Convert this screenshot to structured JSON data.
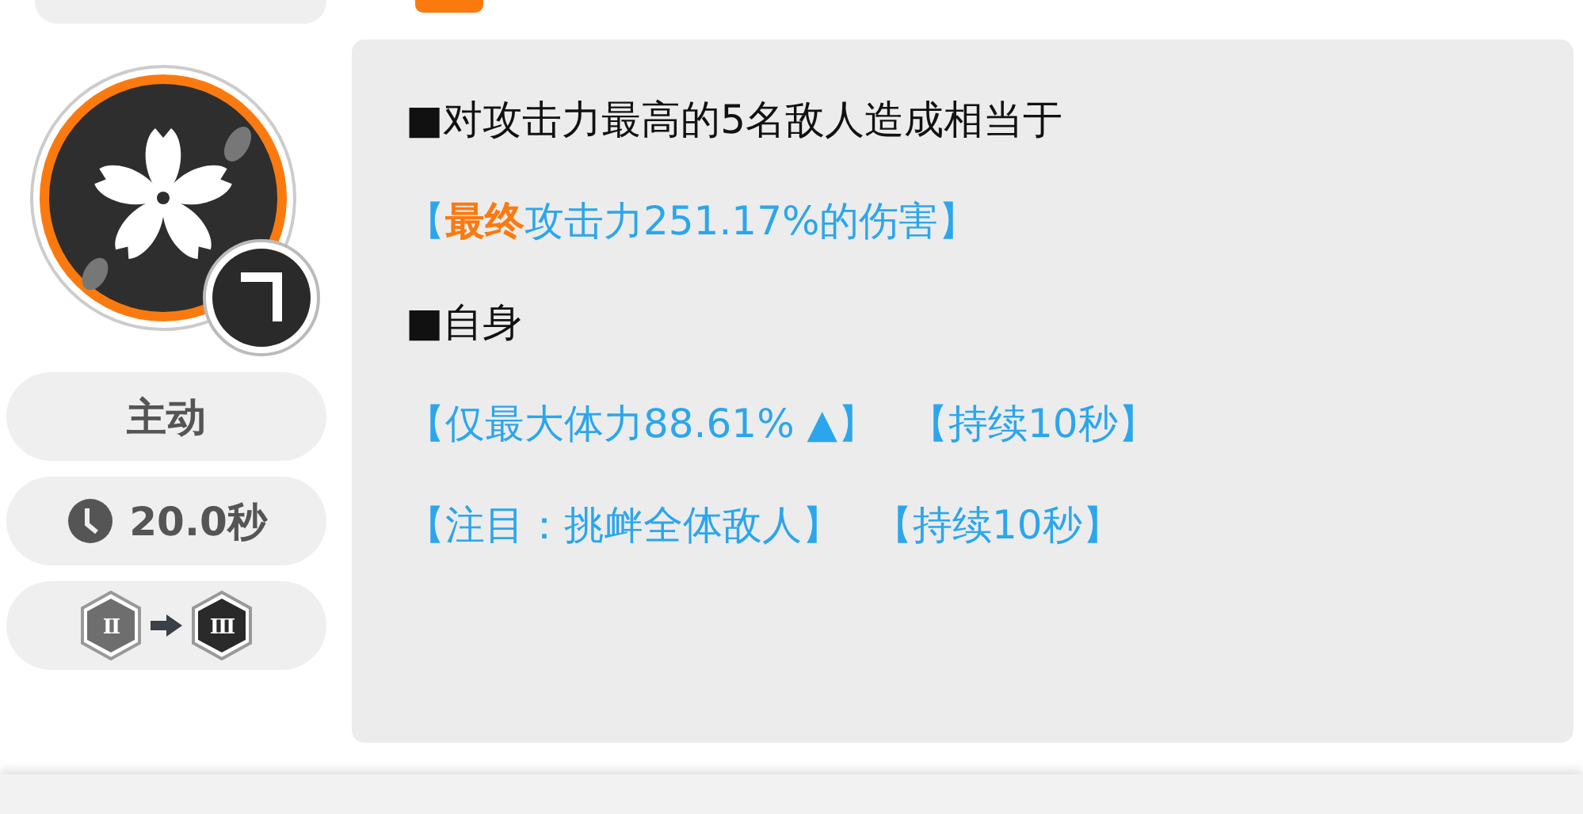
{
  "skill": {
    "type_label": "主动",
    "cooldown": "20.0秒",
    "tiers": [
      {
        "numeral": "II",
        "reached": false
      },
      {
        "numeral": "III",
        "reached": true
      }
    ],
    "lines": [
      {
        "kind": "heading",
        "parts": [
          "■对攻击力最高的5名敌人造成相当于"
        ]
      },
      {
        "kind": "effect",
        "parts": [
          "【**最终**攻击力251.17%的伤害】"
        ]
      },
      {
        "kind": "heading",
        "parts": [
          "■自身"
        ]
      },
      {
        "kind": "effect",
        "parts": [
          "【仅最大体力88.61% ▲】",
          "【持续10秒】"
        ]
      },
      {
        "kind": "effect",
        "parts": [
          "【注目：挑衅全体敌人】",
          "【持续10秒】"
        ]
      }
    ]
  }
}
